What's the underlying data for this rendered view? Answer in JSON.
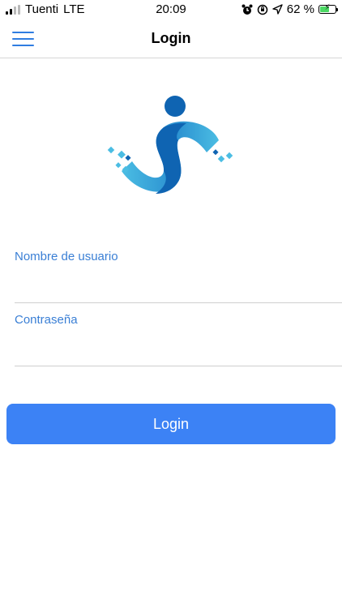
{
  "status_bar": {
    "carrier": "Tuenti",
    "network": "LTE",
    "time": "20:09",
    "battery_percent": "62 %",
    "battery_level": 0.62,
    "battery_color": "#4cd964"
  },
  "nav": {
    "title": "Login",
    "menu_icon": "hamburger-menu-icon"
  },
  "logo": {
    "icon": "app-logo",
    "colors": {
      "dark_blue": "#0f64b2",
      "light_blue": "#4bbde3"
    }
  },
  "form": {
    "username": {
      "label": "Nombre de usuario",
      "value": ""
    },
    "password": {
      "label": "Contraseña",
      "value": ""
    },
    "login_button": "Login"
  },
  "colors": {
    "accent": "#2f7de1",
    "label": "#3a7fd5",
    "button": "#3c82f5"
  }
}
